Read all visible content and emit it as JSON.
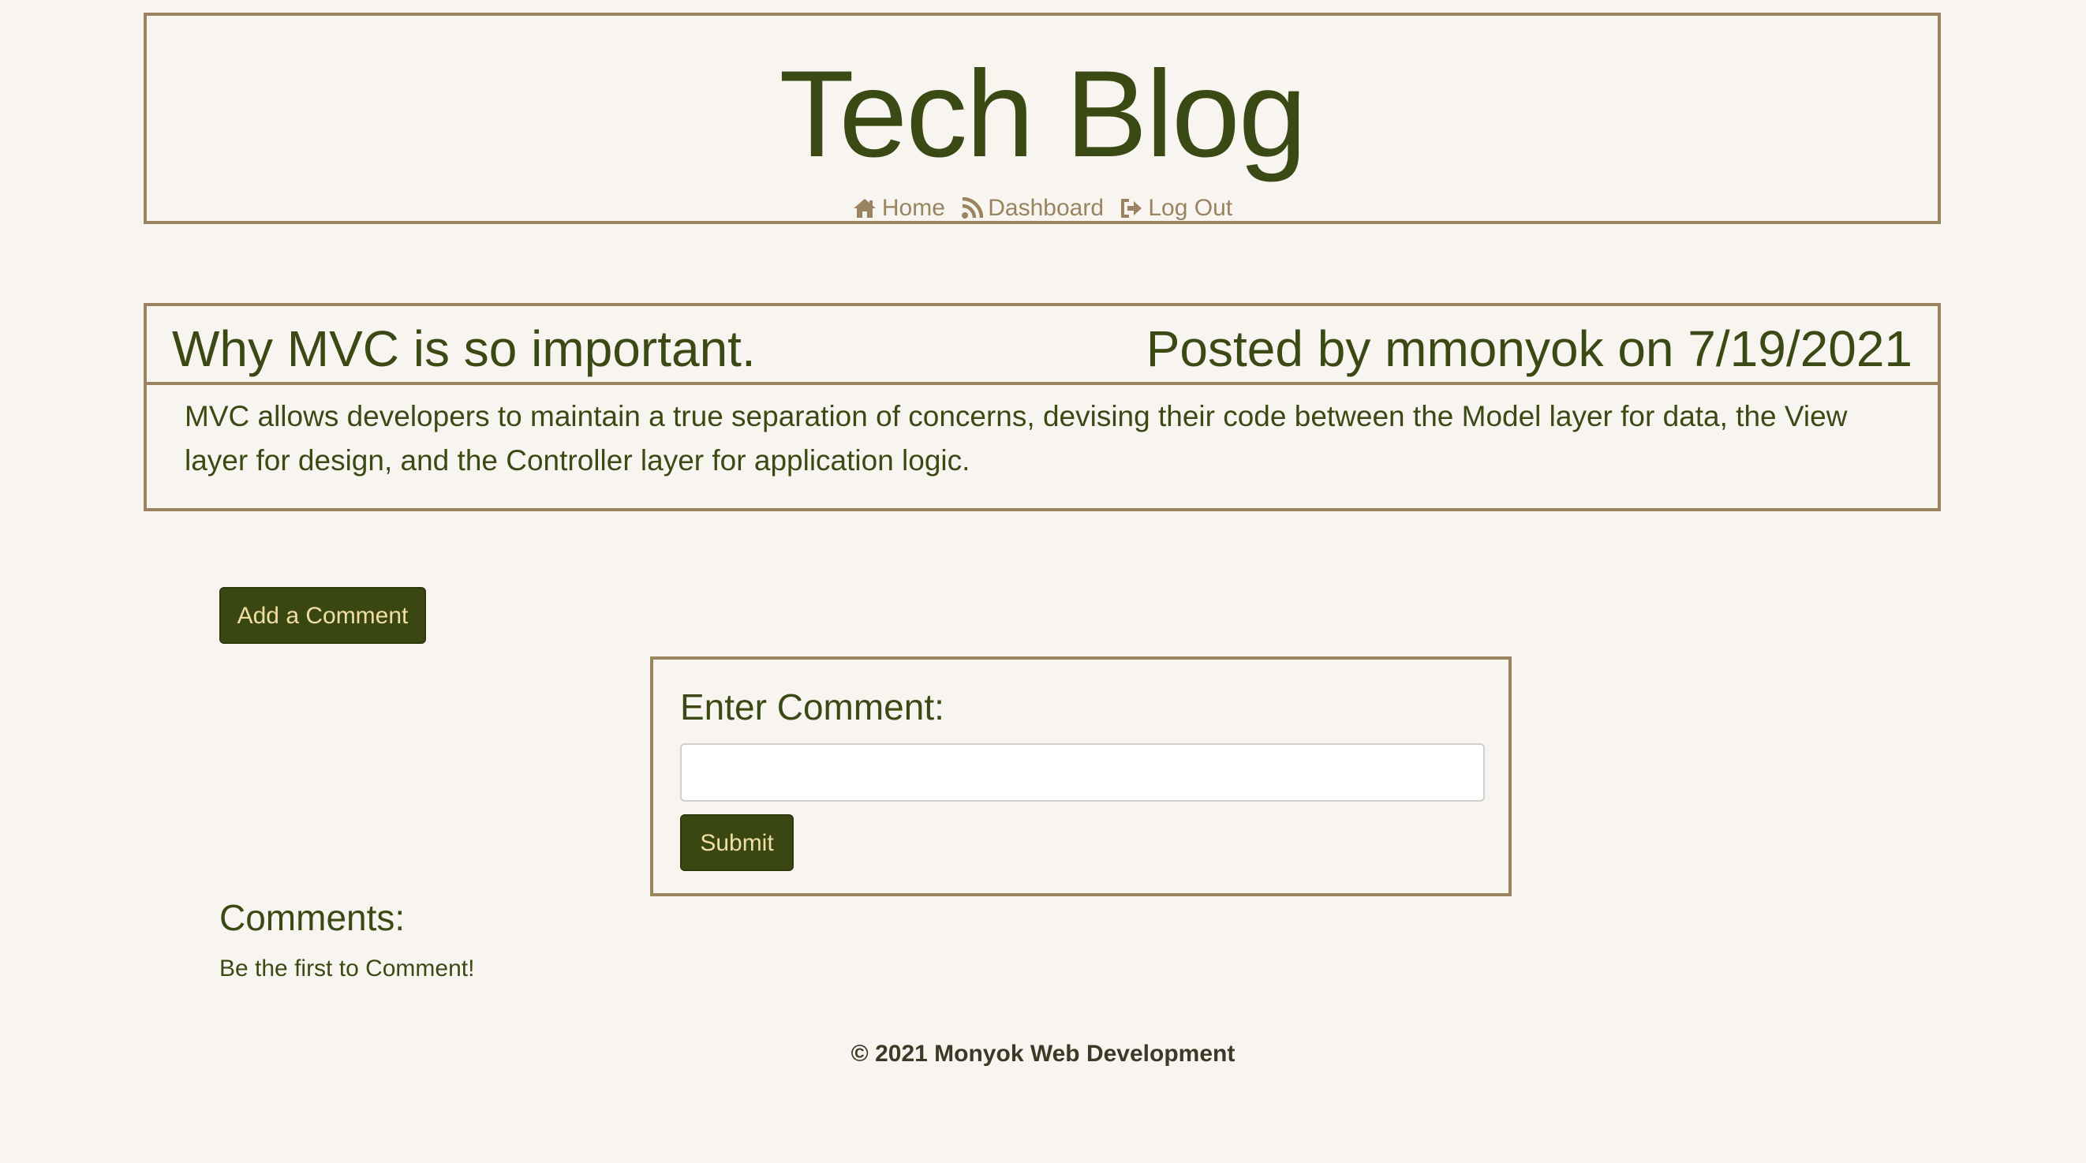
{
  "site": {
    "title": "Tech Blog"
  },
  "nav": {
    "items": [
      {
        "label": "Home",
        "icon": "home-icon"
      },
      {
        "label": "Dashboard",
        "icon": "rss-icon"
      },
      {
        "label": "Log Out",
        "icon": "sign-out-icon"
      }
    ]
  },
  "post": {
    "title": "Why MVC is so important.",
    "meta": "Posted by mmonyok on 7/19/2021",
    "body": "MVC allows developers to maintain a true separation of concerns, devising their code between the Model layer for data, the View layer for design, and the Controller layer for application logic."
  },
  "comment_form": {
    "add_button_label": "Add a Comment",
    "label": "Enter Comment:",
    "input_value": "",
    "submit_label": "Submit"
  },
  "comments": {
    "heading": "Comments:",
    "empty_message": "Be the first to Comment!"
  },
  "footer": {
    "text": "© 2021 Monyok Web Development"
  },
  "colors": {
    "background": "#f8f5f0",
    "primary_text": "#3b4a14",
    "accent_border": "#9a8360",
    "button_bg": "#3b4713",
    "button_text": "#f0dfa2"
  }
}
